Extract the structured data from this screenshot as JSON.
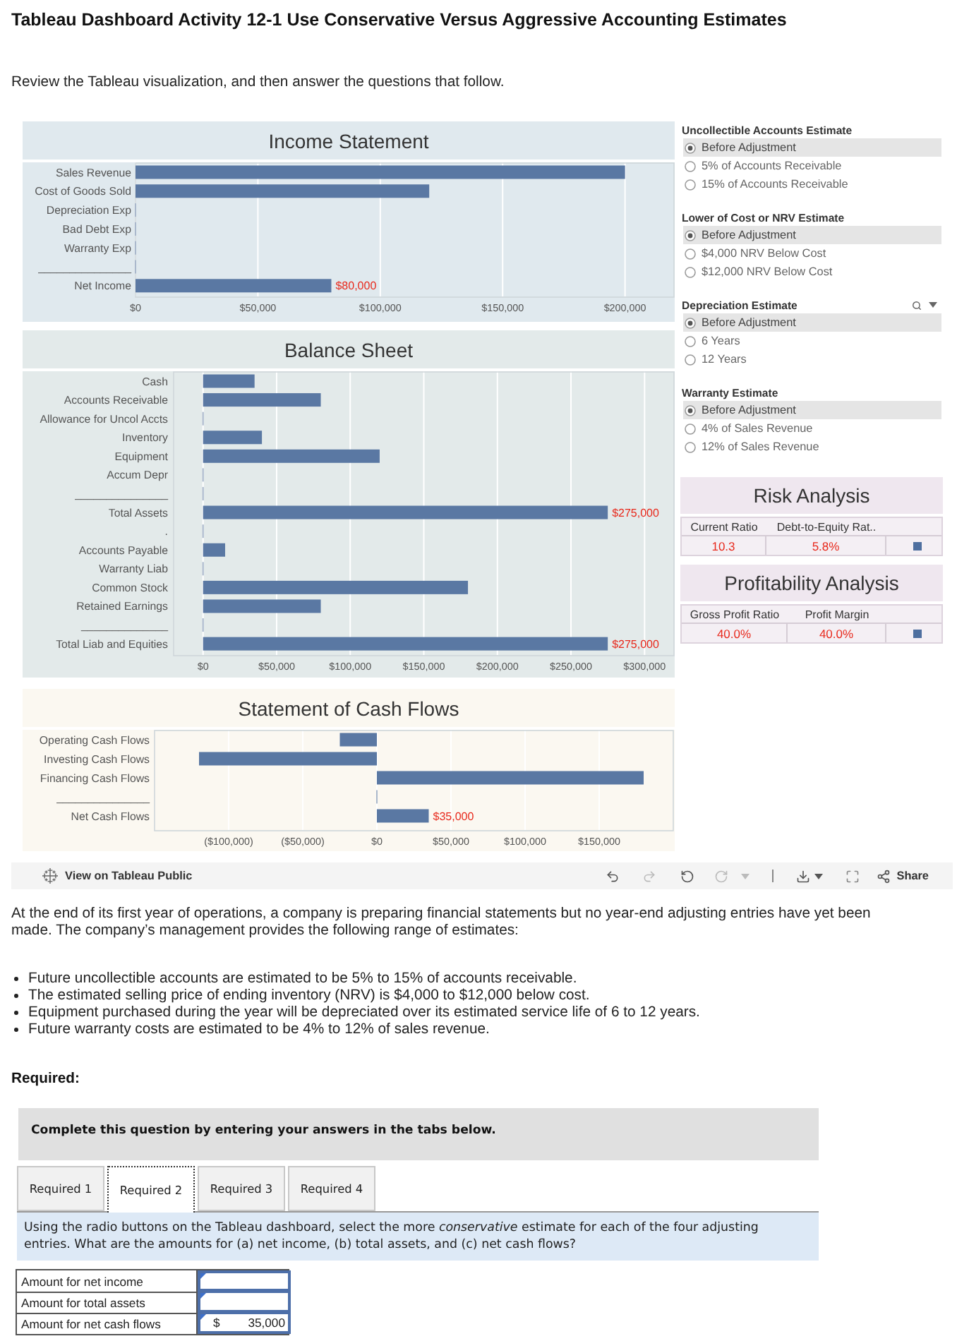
{
  "page": {
    "title": "Tableau Dashboard Activity 12-1 Use Conservative Versus Aggressive Accounting Estimates",
    "intro": "Review the Tableau visualization, and then answer the questions that follow."
  },
  "dashboard": {
    "charts": [
      {
        "title": "Income Statement",
        "chart_data": {
          "type": "bar",
          "orientation": "horizontal",
          "grid": true,
          "categories": [
            "Sales Revenue",
            "Cost of Goods Sold",
            "Depreciation Exp",
            "Bad Debt Exp",
            "Warranty Exp",
            "_______________",
            "Net Income"
          ],
          "values": [
            200000,
            120000,
            0,
            0,
            0,
            0,
            80000
          ],
          "value_labels": [
            null,
            null,
            null,
            null,
            null,
            null,
            "$80,000"
          ],
          "xlim": [
            0,
            220000
          ],
          "xticks": [
            {
              "value": 0,
              "label": "$0"
            },
            {
              "value": 50000,
              "label": "$50,000"
            },
            {
              "value": 100000,
              "label": "$100,000"
            },
            {
              "value": 150000,
              "label": "$150,000"
            },
            {
              "value": 200000,
              "label": "$200,000"
            }
          ]
        }
      },
      {
        "title": "Balance Sheet",
        "chart_data": {
          "type": "bar",
          "orientation": "horizontal",
          "grid": true,
          "categories": [
            "Cash",
            "Accounts Receivable",
            "Allowance for Uncol Accts",
            "Inventory",
            "Equipment",
            "Accum Depr",
            "_______________",
            "Total Assets",
            ".",
            "Accounts Payable",
            "Warranty Liab",
            "Common Stock",
            "Retained Earnings",
            "______________",
            "Total Liab and Equities"
          ],
          "values": [
            35000,
            80000,
            0,
            40000,
            120000,
            0,
            0,
            275000,
            0,
            15000,
            0,
            180000,
            80000,
            0,
            275000
          ],
          "value_labels": [
            null,
            null,
            null,
            null,
            null,
            null,
            null,
            "$275,000",
            null,
            null,
            null,
            null,
            null,
            null,
            "$275,000"
          ],
          "xlim": [
            -20000,
            320000
          ],
          "xticks": [
            {
              "value": 0,
              "label": "$0"
            },
            {
              "value": 50000,
              "label": "$50,000"
            },
            {
              "value": 100000,
              "label": "$100,000"
            },
            {
              "value": 150000,
              "label": "$150,000"
            },
            {
              "value": 200000,
              "label": "$200,000"
            },
            {
              "value": 250000,
              "label": "$250,000"
            },
            {
              "value": 300000,
              "label": "$300,000"
            }
          ]
        }
      },
      {
        "title": "Statement of Cash Flows",
        "chart_data": {
          "type": "bar",
          "orientation": "horizontal",
          "grid": true,
          "categories": [
            "Operating Cash Flows",
            "Investing Cash Flows",
            "Financing Cash Flows",
            "_______________",
            "Net Cash Flows"
          ],
          "values": [
            -25000,
            -120000,
            180000,
            0,
            35000
          ],
          "value_labels": [
            null,
            null,
            null,
            null,
            "$35,000"
          ],
          "xlim": [
            -150000,
            200000
          ],
          "xticks": [
            {
              "value": -100000,
              "label": "($100,000)"
            },
            {
              "value": -50000,
              "label": "($50,000)"
            },
            {
              "value": 0,
              "label": "$0"
            },
            {
              "value": 50000,
              "label": "$50,000"
            },
            {
              "value": 100000,
              "label": "$100,000"
            },
            {
              "value": 150000,
              "label": "$150,000"
            }
          ]
        }
      }
    ],
    "filters": [
      {
        "title": "Uncollectible Accounts Estimate",
        "controls_shown": false,
        "options": [
          {
            "label": "Before Adjustment",
            "selected": true
          },
          {
            "label": "5% of Accounts Receivable",
            "selected": false
          },
          {
            "label": "15% of Accounts Receivable",
            "selected": false
          }
        ]
      },
      {
        "title": "Lower of Cost or NRV Estimate",
        "controls_shown": false,
        "options": [
          {
            "label": "Before Adjustment",
            "selected": true
          },
          {
            "label": "$4,000 NRV Below Cost",
            "selected": false
          },
          {
            "label": "$12,000 NRV Below Cost",
            "selected": false
          }
        ]
      },
      {
        "title": "Depreciation Estimate",
        "controls_shown": true,
        "options": [
          {
            "label": "Before Adjustment",
            "selected": true
          },
          {
            "label": "6 Years",
            "selected": false
          },
          {
            "label": "12 Years",
            "selected": false
          }
        ]
      },
      {
        "title": "Warranty Estimate",
        "controls_shown": false,
        "options": [
          {
            "label": "Before Adjustment",
            "selected": true
          },
          {
            "label": "4% of Sales Revenue",
            "selected": false
          },
          {
            "label": "12% of Sales Revenue",
            "selected": false
          }
        ]
      }
    ],
    "analyses": [
      {
        "title": "Risk Analysis",
        "metrics": [
          {
            "label": "Current Ratio",
            "value": "10.3"
          },
          {
            "label": "Debt-to-Equity Rat..",
            "value": "5.8%"
          }
        ]
      },
      {
        "title": "Profitability Analysis",
        "metrics": [
          {
            "label": "Gross Profit Ratio",
            "value": "40.0%"
          },
          {
            "label": "Profit Margin",
            "value": "40.0%"
          }
        ]
      }
    ],
    "toolbar": {
      "link": "View on Tableau Public",
      "share": "Share"
    }
  },
  "problem": {
    "paragraph": "At the end of its first year of operations, a company is preparing financial statements but no year-end adjusting entries have yet been made. The company’s management provides the following range of estimates:",
    "bullets": [
      "Future uncollectible accounts are estimated to be 5% to 15% of accounts receivable.",
      "The estimated selling price of ending inventory (NRV) is $4,000 to $12,000 below cost.",
      "Equipment purchased during the year will be depreciated over its estimated service life of 6 to 12 years.",
      "Future warranty costs are estimated to be 4% to 12% of sales revenue."
    ],
    "required_label": "Required:"
  },
  "question": {
    "instruction": "Complete this question by entering your answers in the tabs below.",
    "tabs": [
      {
        "label": "Required 1",
        "selected": false
      },
      {
        "label": "Required 2",
        "selected": true
      },
      {
        "label": "Required 3",
        "selected": false
      },
      {
        "label": "Required 4",
        "selected": false
      }
    ],
    "prompt": "Using the radio buttons on the Tableau dashboard, select the more *conservative* estimate for each of the four adjusting entries. What are the amounts for (a) net income, (b) total assets, and (c) net cash flows?",
    "answers": [
      {
        "label": "Amount for net income"
      },
      {
        "label": "Amount for total assets"
      },
      {
        "label": "Amount for net cash flows",
        "currency": "$",
        "value": "35,000"
      }
    ]
  }
}
